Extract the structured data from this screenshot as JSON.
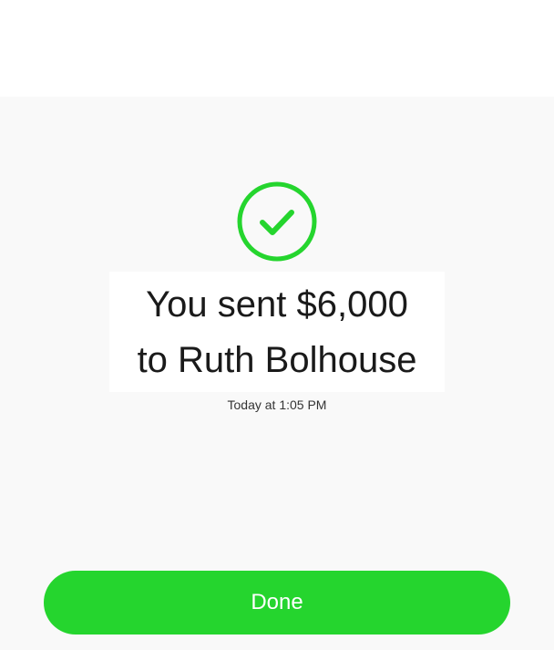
{
  "confirmation": {
    "icon": "checkmark-circle-icon",
    "accent_color": "#25d52e",
    "message_line1": "You sent $6,000",
    "message_line2": "to Ruth Bolhouse",
    "timestamp": "Today at 1:05 PM"
  },
  "actions": {
    "done_label": "Done"
  }
}
